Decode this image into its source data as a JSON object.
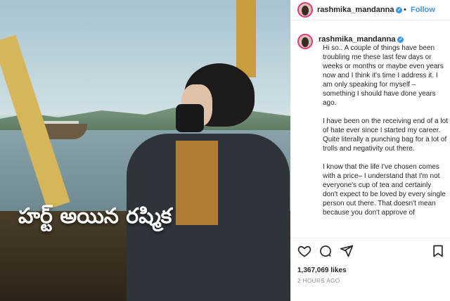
{
  "overlay": {
    "title": "హర్ట్ అయిన రష్మిక"
  },
  "header": {
    "username": "rashmika_mandanna",
    "verified": "✓",
    "separator": "•",
    "follow_label": "Follow"
  },
  "caption": {
    "username": "rashmika_mandanna",
    "verified": "✓",
    "paragraphs": [
      "Hi so.. A couple of things have been troubling me these last few days or weeks or months or maybe even years now and I think it's time I address it. I am only speaking for myself – something I should have done years ago.",
      "I have been on the receiving end of a lot of hate ever since I started my career. Quite literally a punching bag for a lot of trolls and negativity out there.",
      "I know that the life I've chosen comes with a price– I understand that I'm not everyone's cup of tea and certainly don't expect to be loved by every single person out there. That doesn't mean because you don't approve of"
    ]
  },
  "actions": {
    "likes": "1,367,069 likes",
    "date": "2 HOURS AGO"
  },
  "icons": [
    "heart-icon",
    "comment-icon",
    "share-icon",
    "bookmark-icon"
  ]
}
